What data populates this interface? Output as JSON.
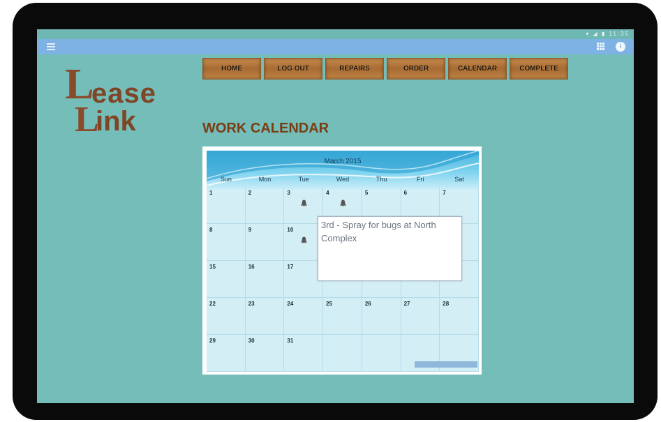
{
  "statusbar": {
    "time": "11:35"
  },
  "logo": {
    "line1_initial": "L",
    "line1_rest": "ease",
    "line2_initial": "L",
    "line2_rest": "ink"
  },
  "nav": {
    "items": [
      "HOME",
      "LOG OUT",
      "REPAIRS",
      "ORDER",
      "CALENDAR",
      "COMPLETE"
    ]
  },
  "page": {
    "title": "WORK CALENDAR"
  },
  "calendar": {
    "month_label": "March 2015",
    "weekdays": [
      "Sun",
      "Mon",
      "Tue",
      "Wed",
      "Thu",
      "Fri",
      "Sat"
    ],
    "weeks": [
      [
        "1",
        "2",
        "3",
        "4",
        "5",
        "6",
        "7"
      ],
      [
        "8",
        "9",
        "10",
        "",
        "",
        "",
        ""
      ],
      [
        "15",
        "16",
        "17",
        "",
        "",
        "",
        ""
      ],
      [
        "22",
        "23",
        "24",
        "25",
        "26",
        "27",
        "28"
      ],
      [
        "29",
        "30",
        "31",
        "",
        "",
        "",
        ""
      ]
    ],
    "event_days": [
      "3",
      "4",
      "10"
    ],
    "popup_text": "3rd - Spray for bugs at North Complex"
  },
  "colors": {
    "screen_bg": "#74bdb8",
    "title": "#7b3d14",
    "actionbar": "#7eb2e4"
  },
  "icons": [
    "menu-icon",
    "grid-icon",
    "info-icon",
    "bell-icon"
  ]
}
